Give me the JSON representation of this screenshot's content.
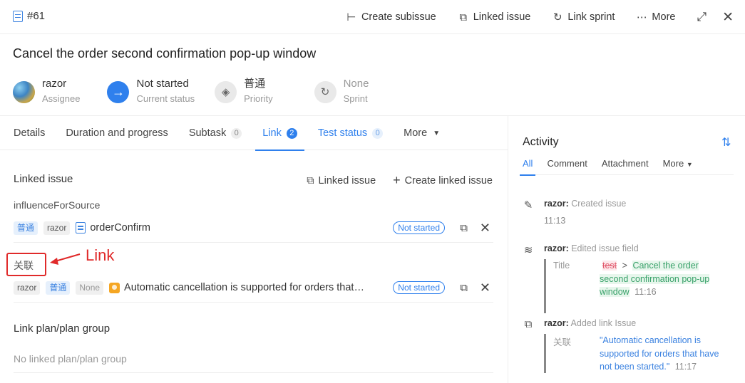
{
  "header": {
    "issue_id": "#61",
    "actions": [
      {
        "label": "Create subissue",
        "icon": "subissue-icon"
      },
      {
        "label": "Linked issue",
        "icon": "linked-issue-icon"
      },
      {
        "label": "Link sprint",
        "icon": "sprint-icon"
      },
      {
        "label": "More",
        "icon": "more-dots-icon"
      }
    ]
  },
  "issue": {
    "title": "Cancel the order second confirmation pop-up window",
    "assignee": {
      "value": "razor",
      "label": "Assignee"
    },
    "status": {
      "value": "Not started",
      "label": "Current status"
    },
    "priority": {
      "value": "普通",
      "label": "Priority"
    },
    "sprint": {
      "value": "None",
      "label": "Sprint"
    }
  },
  "tabs": [
    {
      "label": "Details"
    },
    {
      "label": "Duration and progress"
    },
    {
      "label": "Subtask",
      "count": "0"
    },
    {
      "label": "Link",
      "count": "2"
    },
    {
      "label": "Test status",
      "count": "0"
    },
    {
      "label": "More"
    }
  ],
  "linked": {
    "heading": "Linked issue",
    "action_linked": "Linked issue",
    "action_create": "Create linked issue",
    "group1": {
      "label": "influenceForSource",
      "priority": "普通",
      "assignee": "razor",
      "name": "orderConfirm",
      "status": "Not started"
    },
    "group2": {
      "label": "关联",
      "assignee": "razor",
      "priority": "普通",
      "sprint": "None",
      "name": "Automatic cancellation is supported for orders that …",
      "status": "Not started"
    },
    "annotation": "Link"
  },
  "plan": {
    "heading": "Link plan/plan group",
    "empty": "No linked plan/plan group"
  },
  "activity": {
    "title": "Activity",
    "tabs": [
      "All",
      "Comment",
      "Attachment",
      "More"
    ],
    "items": [
      {
        "user": "razor:",
        "action": "Created issue",
        "time": "11:13"
      },
      {
        "user": "razor:",
        "action": "Edited issue field",
        "field": "Title",
        "old": "test",
        "new": "Cancel the order second confirmation pop-up window",
        "time": "11:16"
      },
      {
        "user": "razor:",
        "action": "Added link Issue",
        "field": "关联",
        "value": "\"Automatic cancellation is supported for orders that have not been started.\"",
        "time": "11:17"
      }
    ]
  },
  "colors": {
    "accent": "#2f80ed",
    "annotation": "#e02a2a",
    "added": "#38a169",
    "removed": "#e0566a"
  }
}
